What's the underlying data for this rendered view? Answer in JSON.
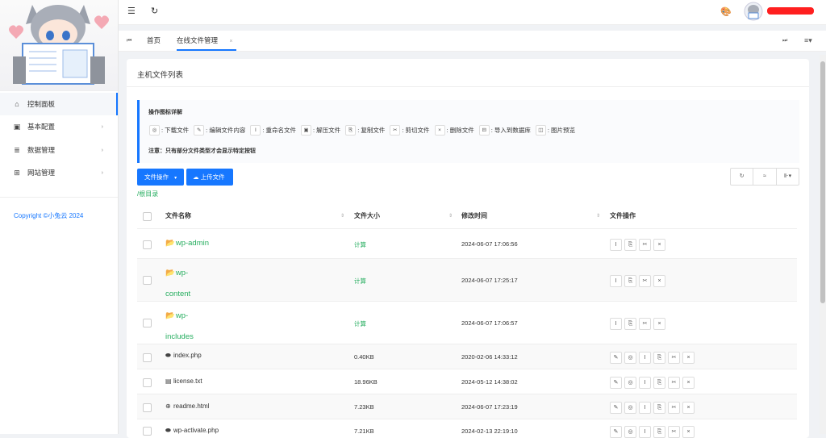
{
  "sidebar": {
    "items": [
      {
        "icon": "home-icon",
        "glyph": "⌂",
        "label": "控制面板"
      },
      {
        "icon": "terminal-icon",
        "glyph": "▣",
        "label": "基本配置"
      },
      {
        "icon": "list-icon",
        "glyph": "≣",
        "label": "数据管理"
      },
      {
        "icon": "sitemap-icon",
        "glyph": "⊞",
        "label": "网站管理"
      }
    ],
    "copyright": "Copyright ©小兔云 2024"
  },
  "tabs": [
    {
      "label": "首页"
    },
    {
      "label": "在线文件管理"
    }
  ],
  "card": {
    "title": "主机文件列表"
  },
  "notice": {
    "title": "操作图标详解",
    "legend": [
      {
        "glyph": "◎",
        "label": ": 下载文件"
      },
      {
        "glyph": "✎",
        "label": ": 编辑文件内容"
      },
      {
        "glyph": "I",
        "label": ": 重命名文件"
      },
      {
        "glyph": "▣",
        "label": ": 解压文件"
      },
      {
        "glyph": "⎘",
        "label": ": 复制文件"
      },
      {
        "glyph": "✂",
        "label": ": 剪切文件"
      },
      {
        "glyph": "×",
        "label": ": 删除文件"
      },
      {
        "glyph": "⊟",
        "label": ": 导入到数据库"
      },
      {
        "glyph": "◫",
        "label": ": 图片预览"
      }
    ],
    "note": "注意：只有部分文件类型才会显示特定按钮"
  },
  "actions": {
    "file_ops": "文件操作",
    "upload": "上传文件",
    "breadcrumb": "/根目录"
  },
  "table": {
    "headers": [
      "文件名称",
      "文件大小",
      "修改时间",
      "文件操作"
    ],
    "rows": [
      {
        "name1": "wp-admin",
        "name2": "",
        "size": "计算",
        "time": "2024-06-07 17:06:56"
      },
      {
        "name1": "wp-",
        "name2": "content",
        "size": "计算",
        "time": "2024-06-07 17:25:17"
      },
      {
        "name1": "wp-",
        "name2": "includes",
        "size": "计算",
        "time": "2024-06-07 17:06:57"
      },
      {
        "name1": "index.php",
        "size": "0.40KB",
        "time": "2020-02-06 14:33:12"
      },
      {
        "name1": "license.txt",
        "size": "18.96KB",
        "time": "2024-05-12 14:38:02"
      },
      {
        "name1": "readme.html",
        "size": "7.23KB",
        "time": "2024-06-07 17:23:19"
      },
      {
        "name1": "wp-activate.php",
        "size": "7.21KB",
        "time": "2024-02-13 22:19:10"
      }
    ]
  },
  "colors": {
    "accent": "#1677ff",
    "folder": "#27ae60"
  }
}
